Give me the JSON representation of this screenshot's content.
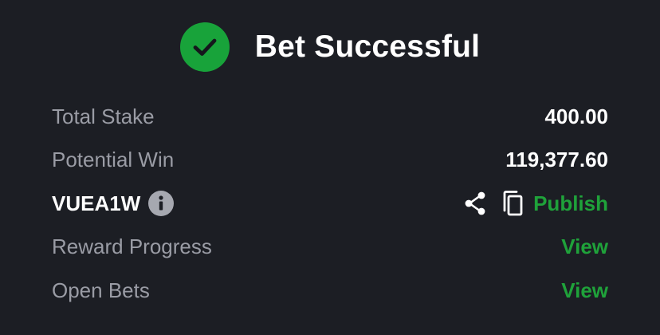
{
  "header": {
    "title": "Bet Successful",
    "icon": "check-circle-icon",
    "accent": "#18a33a"
  },
  "rows": {
    "total_stake": {
      "label": "Total Stake",
      "value": "400.00"
    },
    "potential_win": {
      "label": "Potential Win",
      "value": "119,377.60"
    },
    "booking": {
      "code": "VUEA1W",
      "info_icon": "info-icon",
      "share_icon": "share-icon",
      "copy_icon": "copy-icon",
      "publish_label": "Publish"
    },
    "reward_progress": {
      "label": "Reward Progress",
      "link": "View"
    },
    "open_bets": {
      "label": "Open Bets",
      "link": "View"
    }
  },
  "colors": {
    "background": "#1c1e24",
    "label": "#9a9ca5",
    "link": "#1fa23a",
    "text": "#ffffff"
  }
}
